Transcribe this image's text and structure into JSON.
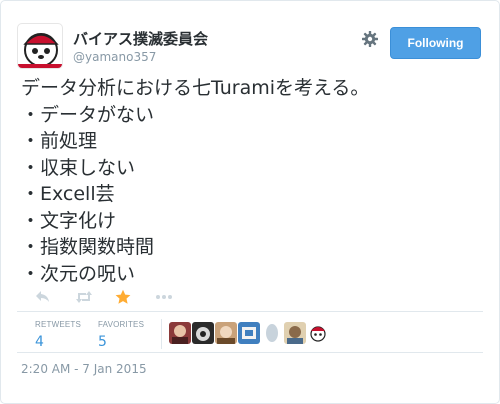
{
  "user": {
    "display_name": "バイアス撲滅委員会",
    "screen_name": "@yamano357"
  },
  "follow_button": {
    "label": "Following"
  },
  "tweet": {
    "lines": [
      "データ分析における七Turamiを考える。",
      "・データがない",
      "・前処理",
      "・収束しない",
      "・Excell芸",
      "・文字化け",
      "・指数関数時間",
      "・次元の呪い"
    ]
  },
  "stats": {
    "retweets": {
      "label": "RETWEETS",
      "value": "4"
    },
    "favorites": {
      "label": "FAVORITES",
      "value": "5"
    }
  },
  "timestamp": "2:20 AM - 7 Jan 2015",
  "icons": {
    "settings": "gear-icon",
    "reply": "reply-icon",
    "retweet": "retweet-icon",
    "favorite": "star-icon",
    "more": "more-icon"
  },
  "colors": {
    "follow_button": "#4fa0e5",
    "favorite_active": "#ffac33",
    "stat_value": "#3b94d9",
    "secondary_text": "#8899a6"
  }
}
